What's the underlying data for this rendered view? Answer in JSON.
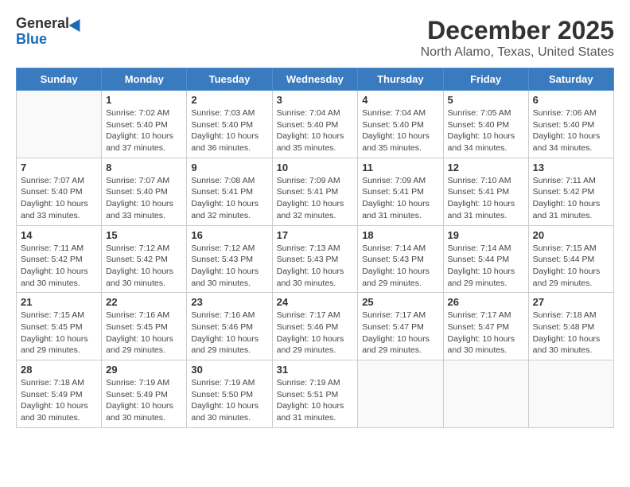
{
  "header": {
    "logo_general": "General",
    "logo_blue": "Blue",
    "month_title": "December 2025",
    "location": "North Alamo, Texas, United States"
  },
  "days_of_week": [
    "Sunday",
    "Monday",
    "Tuesday",
    "Wednesday",
    "Thursday",
    "Friday",
    "Saturday"
  ],
  "weeks": [
    [
      {
        "day": "",
        "info": ""
      },
      {
        "day": "1",
        "info": "Sunrise: 7:02 AM\nSunset: 5:40 PM\nDaylight: 10 hours\nand 37 minutes."
      },
      {
        "day": "2",
        "info": "Sunrise: 7:03 AM\nSunset: 5:40 PM\nDaylight: 10 hours\nand 36 minutes."
      },
      {
        "day": "3",
        "info": "Sunrise: 7:04 AM\nSunset: 5:40 PM\nDaylight: 10 hours\nand 35 minutes."
      },
      {
        "day": "4",
        "info": "Sunrise: 7:04 AM\nSunset: 5:40 PM\nDaylight: 10 hours\nand 35 minutes."
      },
      {
        "day": "5",
        "info": "Sunrise: 7:05 AM\nSunset: 5:40 PM\nDaylight: 10 hours\nand 34 minutes."
      },
      {
        "day": "6",
        "info": "Sunrise: 7:06 AM\nSunset: 5:40 PM\nDaylight: 10 hours\nand 34 minutes."
      }
    ],
    [
      {
        "day": "7",
        "info": "Sunrise: 7:07 AM\nSunset: 5:40 PM\nDaylight: 10 hours\nand 33 minutes."
      },
      {
        "day": "8",
        "info": "Sunrise: 7:07 AM\nSunset: 5:40 PM\nDaylight: 10 hours\nand 33 minutes."
      },
      {
        "day": "9",
        "info": "Sunrise: 7:08 AM\nSunset: 5:41 PM\nDaylight: 10 hours\nand 32 minutes."
      },
      {
        "day": "10",
        "info": "Sunrise: 7:09 AM\nSunset: 5:41 PM\nDaylight: 10 hours\nand 32 minutes."
      },
      {
        "day": "11",
        "info": "Sunrise: 7:09 AM\nSunset: 5:41 PM\nDaylight: 10 hours\nand 31 minutes."
      },
      {
        "day": "12",
        "info": "Sunrise: 7:10 AM\nSunset: 5:41 PM\nDaylight: 10 hours\nand 31 minutes."
      },
      {
        "day": "13",
        "info": "Sunrise: 7:11 AM\nSunset: 5:42 PM\nDaylight: 10 hours\nand 31 minutes."
      }
    ],
    [
      {
        "day": "14",
        "info": "Sunrise: 7:11 AM\nSunset: 5:42 PM\nDaylight: 10 hours\nand 30 minutes."
      },
      {
        "day": "15",
        "info": "Sunrise: 7:12 AM\nSunset: 5:42 PM\nDaylight: 10 hours\nand 30 minutes."
      },
      {
        "day": "16",
        "info": "Sunrise: 7:12 AM\nSunset: 5:43 PM\nDaylight: 10 hours\nand 30 minutes."
      },
      {
        "day": "17",
        "info": "Sunrise: 7:13 AM\nSunset: 5:43 PM\nDaylight: 10 hours\nand 30 minutes."
      },
      {
        "day": "18",
        "info": "Sunrise: 7:14 AM\nSunset: 5:43 PM\nDaylight: 10 hours\nand 29 minutes."
      },
      {
        "day": "19",
        "info": "Sunrise: 7:14 AM\nSunset: 5:44 PM\nDaylight: 10 hours\nand 29 minutes."
      },
      {
        "day": "20",
        "info": "Sunrise: 7:15 AM\nSunset: 5:44 PM\nDaylight: 10 hours\nand 29 minutes."
      }
    ],
    [
      {
        "day": "21",
        "info": "Sunrise: 7:15 AM\nSunset: 5:45 PM\nDaylight: 10 hours\nand 29 minutes."
      },
      {
        "day": "22",
        "info": "Sunrise: 7:16 AM\nSunset: 5:45 PM\nDaylight: 10 hours\nand 29 minutes."
      },
      {
        "day": "23",
        "info": "Sunrise: 7:16 AM\nSunset: 5:46 PM\nDaylight: 10 hours\nand 29 minutes."
      },
      {
        "day": "24",
        "info": "Sunrise: 7:17 AM\nSunset: 5:46 PM\nDaylight: 10 hours\nand 29 minutes."
      },
      {
        "day": "25",
        "info": "Sunrise: 7:17 AM\nSunset: 5:47 PM\nDaylight: 10 hours\nand 29 minutes."
      },
      {
        "day": "26",
        "info": "Sunrise: 7:17 AM\nSunset: 5:47 PM\nDaylight: 10 hours\nand 30 minutes."
      },
      {
        "day": "27",
        "info": "Sunrise: 7:18 AM\nSunset: 5:48 PM\nDaylight: 10 hours\nand 30 minutes."
      }
    ],
    [
      {
        "day": "28",
        "info": "Sunrise: 7:18 AM\nSunset: 5:49 PM\nDaylight: 10 hours\nand 30 minutes."
      },
      {
        "day": "29",
        "info": "Sunrise: 7:19 AM\nSunset: 5:49 PM\nDaylight: 10 hours\nand 30 minutes."
      },
      {
        "day": "30",
        "info": "Sunrise: 7:19 AM\nSunset: 5:50 PM\nDaylight: 10 hours\nand 30 minutes."
      },
      {
        "day": "31",
        "info": "Sunrise: 7:19 AM\nSunset: 5:51 PM\nDaylight: 10 hours\nand 31 minutes."
      },
      {
        "day": "",
        "info": ""
      },
      {
        "day": "",
        "info": ""
      },
      {
        "day": "",
        "info": ""
      }
    ]
  ]
}
